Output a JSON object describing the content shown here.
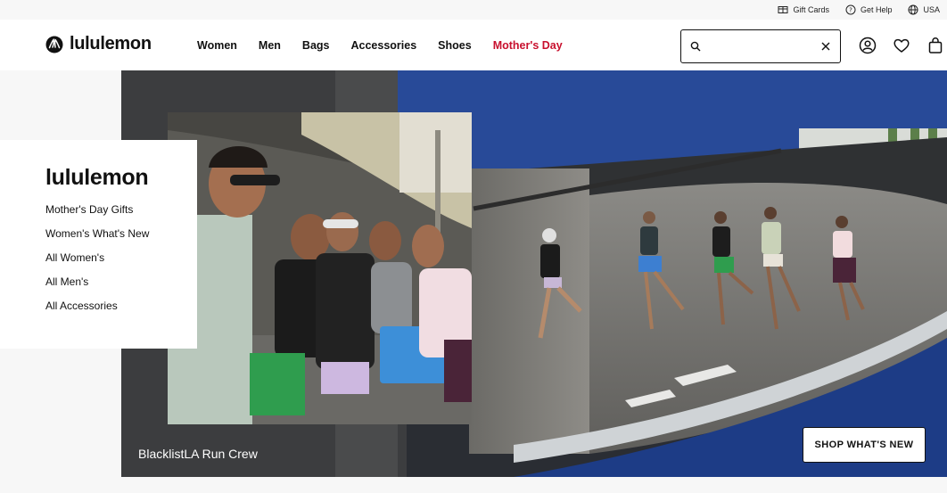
{
  "utility": {
    "gift_cards": "Gift Cards",
    "get_help": "Get Help",
    "region": "USA"
  },
  "header": {
    "logo_text": "lululemon",
    "nav": [
      "Women",
      "Men",
      "Bags",
      "Accessories",
      "Shoes",
      "Mother's Day"
    ],
    "search_placeholder": ""
  },
  "side_card": {
    "title": "lululemon",
    "links": [
      "Mother's Day Gifts",
      "Women's What's New",
      "All Women's",
      "All Men's",
      "All Accessories"
    ]
  },
  "hero": {
    "caption": "BlacklistLA Run Crew",
    "cta": "SHOP WHAT'S NEW"
  },
  "colors": {
    "accent": "#c8102e",
    "ramp_blue": "#1f3f8a"
  }
}
